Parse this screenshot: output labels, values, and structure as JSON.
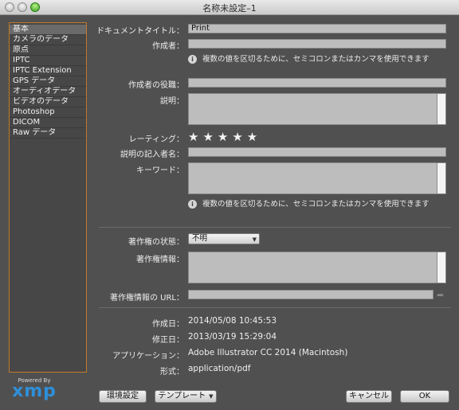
{
  "window": {
    "title": "名称未設定–1"
  },
  "categories": [
    "基本",
    "カメラのデータ",
    "原点",
    "IPTC",
    "IPTC Extension",
    "GPS データ",
    "オーディオデータ",
    "ビデオのデータ",
    "Photoshop",
    "DICOM",
    "Raw データ"
  ],
  "selected_category": "基本",
  "logo": {
    "powered_by": "Powered By",
    "name": "xmp"
  },
  "form": {
    "doc_title_label": "ドキュメントタイトル：",
    "doc_title_value": "Print",
    "author_label": "作成者：",
    "author_value": "",
    "note": "複数の値を区切るために、セミコロンまたはカンマを使用できます",
    "author_role_label": "作成者の役職：",
    "description_label": "説明：",
    "rating_label": "レーティング：",
    "rating_value": 5,
    "rating_stars": "★★★★★",
    "desc_writer_label": "説明の記入者名：",
    "keywords_label": "キーワード：",
    "copyright_status_label": "著作権の状態：",
    "copyright_status_value": "不明",
    "copyright_info_label": "著作権情報：",
    "copyright_url_label": "著作権情報の URL：",
    "created_label": "作成日：",
    "created_value": "2014/05/08 10:45:53",
    "modified_label": "修正日：",
    "modified_value": "2013/03/19 15:29:04",
    "application_label": "アプリケーション：",
    "application_value": "Adobe Illustrator CC 2014 (Macintosh)",
    "format_label": "形式：",
    "format_value": "application/pdf"
  },
  "buttons": {
    "preferences": "環境設定",
    "template": "テンプレート",
    "cancel": "キャンセル",
    "ok": "OK"
  }
}
